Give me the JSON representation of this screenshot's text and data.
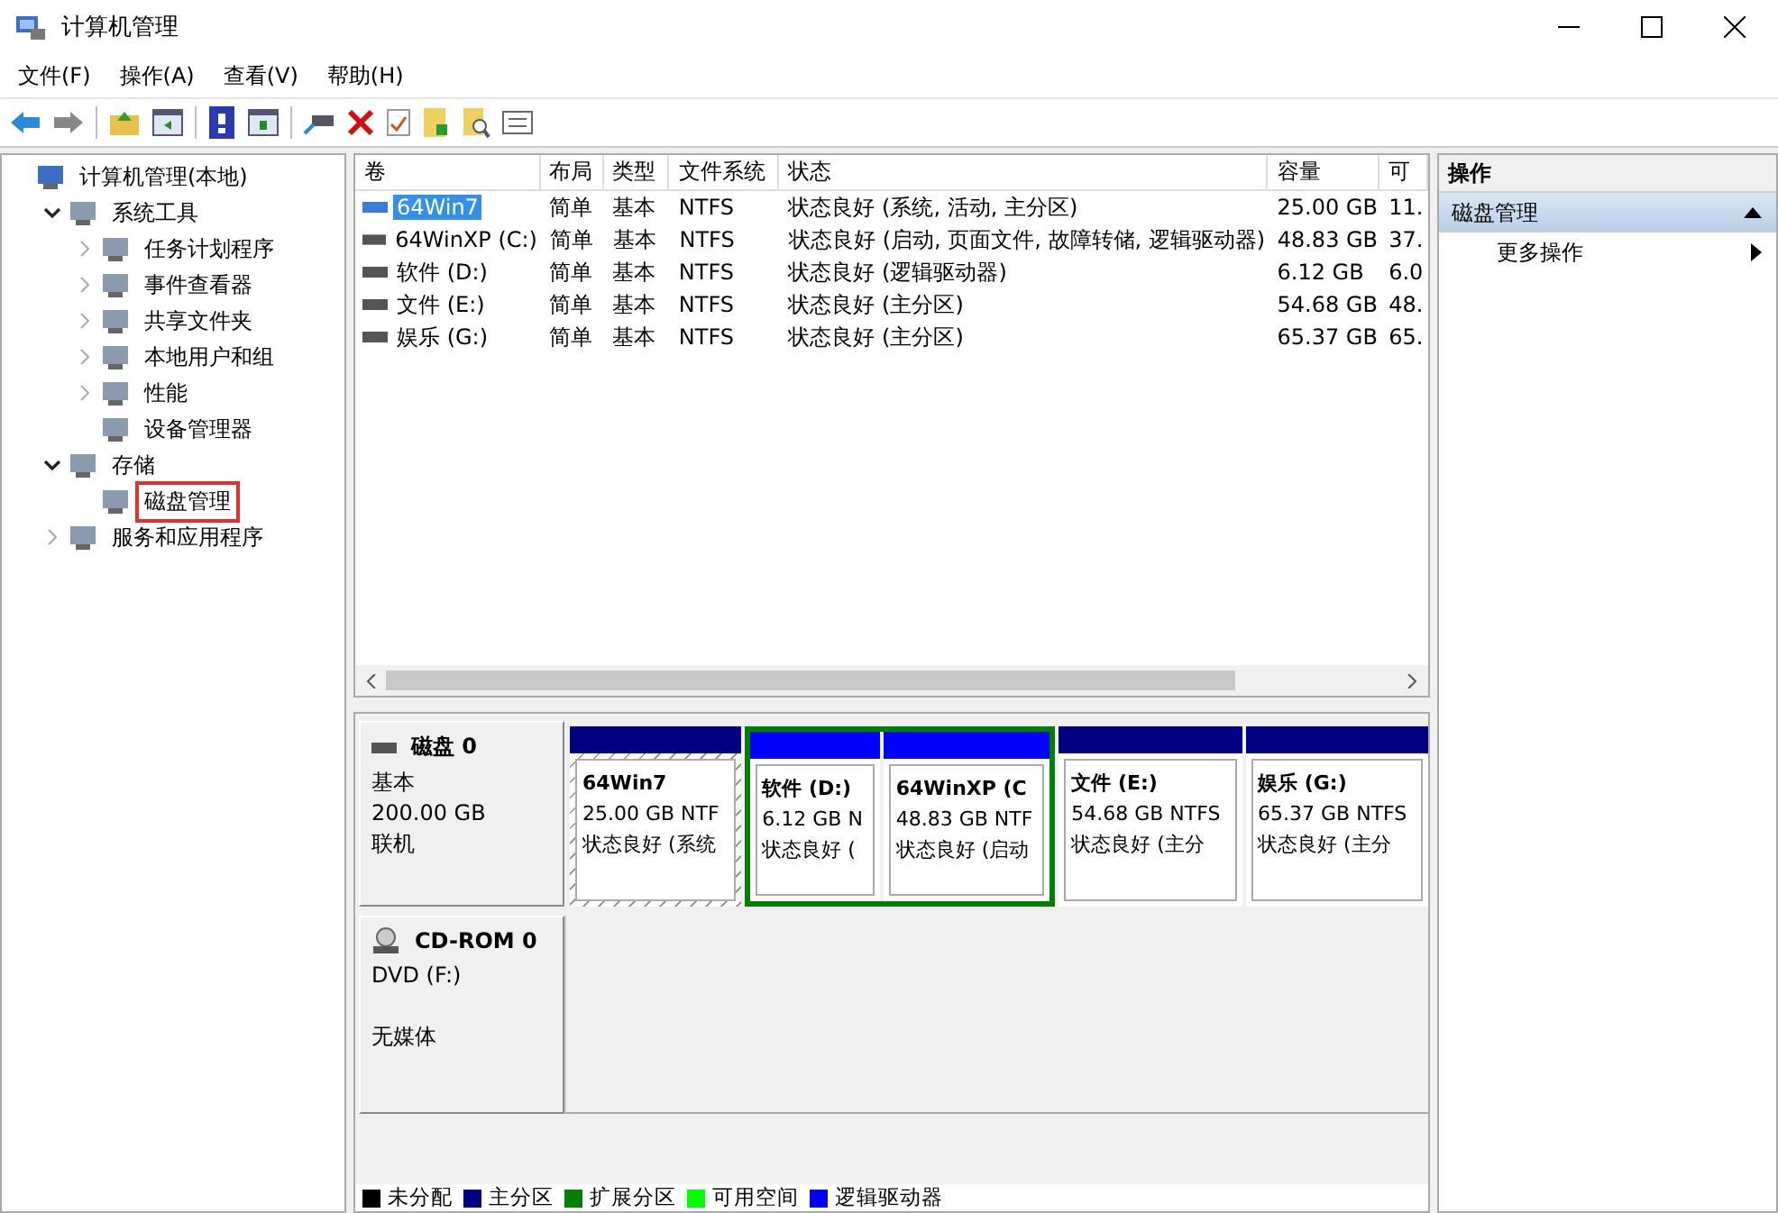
{
  "window": {
    "title": "计算机管理"
  },
  "menu": [
    "文件(F)",
    "操作(A)",
    "查看(V)",
    "帮助(H)"
  ],
  "tree": [
    {
      "label": "计算机管理(本地)",
      "kind": "root",
      "selected": false,
      "children": [
        {
          "label": "系统工具",
          "kind": "folder",
          "expanded": true,
          "selected": false,
          "children": [
            {
              "label": "任务计划程序",
              "kind": "folder",
              "expanded": false,
              "selected": false
            },
            {
              "label": "事件查看器",
              "kind": "folder",
              "expanded": false,
              "selected": false
            },
            {
              "label": "共享文件夹",
              "kind": "folder",
              "expanded": false,
              "selected": false
            },
            {
              "label": "本地用户和组",
              "kind": "folder",
              "expanded": false,
              "selected": false
            },
            {
              "label": "性能",
              "kind": "folder",
              "expanded": false,
              "selected": false
            },
            {
              "label": "设备管理器",
              "kind": "leaf",
              "selected": false
            }
          ]
        },
        {
          "label": "存储",
          "kind": "folder",
          "expanded": true,
          "selected": false,
          "children": [
            {
              "label": "磁盘管理",
              "kind": "leaf",
              "selected": true
            }
          ]
        },
        {
          "label": "服务和应用程序",
          "kind": "folder",
          "expanded": false,
          "selected": false
        }
      ]
    }
  ],
  "table": {
    "columns": [
      "卷",
      "布局",
      "类型",
      "文件系统",
      "状态",
      "容量",
      "可"
    ],
    "rows": [
      {
        "volume": "64Win7",
        "layout": "简单",
        "type": "基本",
        "fs": "NTFS",
        "status": "状态良好 (系统, 活动, 主分区)",
        "capacity": "25.00 GB",
        "column_7": "11.",
        "selected": true
      },
      {
        "volume": "64WinXP  (C:)",
        "layout": "简单",
        "type": "基本",
        "fs": "NTFS",
        "status": "状态良好 (启动, 页面文件, 故障转储, 逻辑驱动器)",
        "capacity": "48.83 GB",
        "column_7": "37.",
        "selected": false
      },
      {
        "volume": "软件 (D:)",
        "layout": "简单",
        "type": "基本",
        "fs": "NTFS",
        "status": "状态良好 (逻辑驱动器)",
        "capacity": "6.12 GB",
        "column_7": "6.0",
        "selected": false
      },
      {
        "volume": "文件 (E:)",
        "layout": "简单",
        "type": "基本",
        "fs": "NTFS",
        "status": "状态良好 (主分区)",
        "capacity": "54.68 GB",
        "column_7": "48.",
        "selected": false
      },
      {
        "volume": "娱乐 (G:)",
        "layout": "简单",
        "type": "基本",
        "fs": "NTFS",
        "status": "状态良好 (主分区)",
        "capacity": "65.37 GB",
        "column_7": "65.",
        "selected": false
      }
    ]
  },
  "disks": [
    {
      "kind": "disk",
      "name": "磁盘 0",
      "lines": [
        "基本",
        "200.00 GB",
        "联机"
      ],
      "partitions": [
        {
          "kind": "primary",
          "color": "#000080",
          "name": "64Win7",
          "size": "25.00 GB NTF",
          "status": "状态良好 (系统",
          "selected": true
        },
        {
          "kind": "extended",
          "color": "#008000",
          "children": [
            {
              "kind": "logical",
              "color": "#0000ff",
              "name": "软件  (D:)",
              "size": "6.12 GB N",
              "status": "状态良好 (",
              "selected": false
            },
            {
              "kind": "logical",
              "color": "#0000ff",
              "name": "64WinXP  (C",
              "size": "48.83 GB NTF",
              "status": "状态良好 (启动",
              "selected": false
            }
          ]
        },
        {
          "kind": "primary",
          "color": "#000080",
          "name": "文件  (E:)",
          "size": "54.68 GB NTFS",
          "status": "状态良好 (主分",
          "selected": false
        },
        {
          "kind": "primary",
          "color": "#000080",
          "name": "娱乐  (G:)",
          "size": "65.37 GB NTFS",
          "status": "状态良好 (主分",
          "selected": false
        }
      ]
    },
    {
      "kind": "cdrom",
      "name": "CD-ROM 0",
      "lines": [
        "DVD (F:)"
      ],
      "status": "无媒体"
    }
  ],
  "legend": [
    {
      "label": "未分配",
      "color": "#000000"
    },
    {
      "label": "主分区",
      "color": "#000080"
    },
    {
      "label": "扩展分区",
      "color": "#008000"
    },
    {
      "label": "可用空间",
      "color": "#00ff00"
    },
    {
      "label": "逻辑驱动器",
      "color": "#0000ff"
    }
  ],
  "actions": {
    "title": "操作",
    "section": {
      "label": "磁盘管理",
      "expanded": true
    },
    "items": [
      "更多操作"
    ]
  }
}
